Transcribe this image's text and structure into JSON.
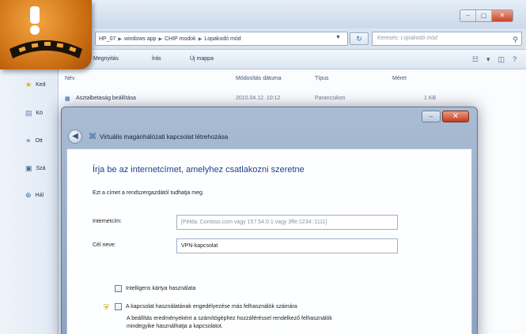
{
  "explorer": {
    "address_crumbs": [
      "HP_07",
      "windows app",
      "CHIP modok",
      "Lopakodó mód"
    ],
    "search_placeholder": "Keresés: Lopakodó mód",
    "toolbar": {
      "open": "Megnyitás",
      "new": "Írás",
      "new_folder": "Új mappa"
    },
    "nav": [
      "Ked",
      "Kö",
      "Ott",
      "Szá",
      "Hál"
    ],
    "columns": {
      "name": "Név",
      "modified": "Módosítás dátuma",
      "type": "Típus",
      "size": "Méret"
    },
    "file": {
      "name": "Asztalbetaság beállítása",
      "modified": "2010.04.12. 10:12",
      "type": "Parancsikon",
      "size": "1 KB"
    }
  },
  "dialog": {
    "title": "Virtuális magánhálózati kapcsolat létrehozása",
    "heading": "Írja be az internetcímet, amelyhez csatlakozni szeretne",
    "subtext": "Ezt a címet a rendszergazdától tudhatja meg.",
    "address_label": "Internetcím:",
    "address_placeholder": "[Példa: Contoso.com vagy 157.54.0.1 vagy 3ffe:1234::1111]",
    "name_label": "Cél neve:",
    "name_value": "VPN-kapcsolat",
    "smartcard_label": "Intelligens kártya használata",
    "share_label": "A kapcsolat használatának engedélyezése más felhasználók számára",
    "share_desc": "A beállítás eredményeként a számítógéphez hozzáféréssel rendelkező felhasználók mindegyike használhatja a kapcsolatot."
  }
}
